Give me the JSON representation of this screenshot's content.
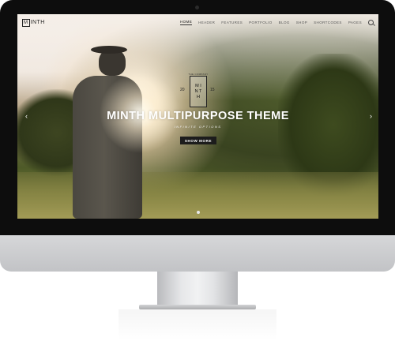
{
  "site": {
    "logo_box": "M",
    "logo_text": "INTH"
  },
  "nav": {
    "items": [
      "HOME",
      "HEADER",
      "FEATURES",
      "PORTFOLIO",
      "BLOG",
      "SHOP",
      "SHORTCODES",
      "PAGES"
    ],
    "active": "HOME"
  },
  "emblem": {
    "top": "THE COMPANY",
    "letters_1": "M I",
    "letters_2": "N T",
    "letters_3": "H",
    "year_left": "20",
    "year_right": "15"
  },
  "hero": {
    "title": "MINTH MULTIPURPOSE THEME",
    "subtitle": "INFINITE OPTIONS",
    "button": "SHOW MORE",
    "arrow_left": "‹",
    "arrow_right": "›"
  },
  "colors": {
    "bezel": "#0d0d0d",
    "button": "#1c1c1c",
    "title": "#ffffff"
  }
}
